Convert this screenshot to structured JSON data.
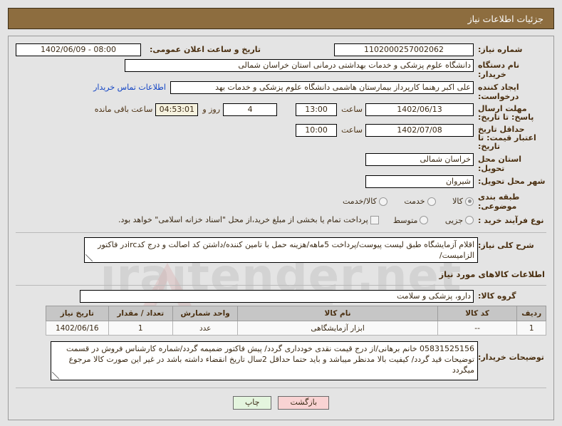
{
  "header": {
    "title": "جزئیات اطلاعات نیاز"
  },
  "form": {
    "need_number_label": "شماره نیاز:",
    "need_number_value": "1102000257002062",
    "announce_datetime_label": "تاریخ و ساعت اعلان عمومی:",
    "announce_datetime_value": "08:00 - 1402/06/09",
    "buyer_org_label": "نام دستگاه خریدار:",
    "buyer_org_value": "دانشگاه علوم پزشکی و خدمات بهداشتی درمانی استان خراسان شمالی",
    "creator_label": "ایجاد کننده درخواست:",
    "creator_value": "علی اکبر رهنما کارپرداز بیمارستان هاشمی دانشگاه علوم پزشکی و خدمات بهد",
    "contact_link": "اطلاعات تماس خریدار",
    "deadline_label": "مهلت ارسال پاسخ: تا تاریخ:",
    "deadline_date": "1402/06/13",
    "deadline_hour_label": "ساعت",
    "deadline_hour": "13:00",
    "remaining_days": "4",
    "remaining_days_label": "روز و",
    "remaining_time": "04:53:01",
    "remaining_time_label": "ساعت باقی مانده",
    "price_validity_label": "حداقل تاریخ اعتبار قیمت: تا تاریخ:",
    "price_validity_date": "1402/07/08",
    "price_validity_hour_label": "ساعت",
    "price_validity_hour": "10:00",
    "province_label": "استان محل تحویل:",
    "province_value": "خراسان شمالی",
    "city_label": "شهر محل تحویل:",
    "city_value": "شیروان",
    "category_label": "طبقه بندی موضوعی:",
    "category_options": [
      {
        "label": "کالا",
        "selected": true
      },
      {
        "label": "خدمت",
        "selected": false
      },
      {
        "label": "کالا/خدمت",
        "selected": false
      }
    ],
    "process_label": "نوع فرآیند خرید :",
    "process_options": [
      {
        "label": "جزیی",
        "selected": false
      },
      {
        "label": "متوسط",
        "selected": false
      }
    ],
    "treasury_checkbox_label": "پرداخت تمام یا بخشی از مبلغ خرید،از محل \"اسناد خزانه اسلامی\" خواهد بود.",
    "description_label": "شرح کلی نیاز:",
    "description_value": "اقلام آزمایشگاه طبق لیست پیوست/پرداخت 5ماهه/هزینه حمل با تامین کننده/داشتن کد اصالت و درج کدircدر فاکتور الزامیست/"
  },
  "goods_section": {
    "heading": "اطلاعات کالاهای مورد نیاز",
    "group_label": "گروه کالا:",
    "group_value": "دارو، پزشکی و سلامت",
    "columns": [
      "ردیف",
      "کد کالا",
      "نام کالا",
      "واحد شمارش",
      "تعداد / مقدار",
      "تاریخ نیاز"
    ],
    "rows": [
      {
        "index": "1",
        "code": "--",
        "name": "ابزار آزمایشگاهی",
        "unit": "عدد",
        "quantity": "1",
        "need_date": "1402/06/16"
      }
    ]
  },
  "buyer_notes": {
    "label": "توضیحات خریدار:",
    "value": "05831525156  خانم برهانی/از درج قیمت نقدی خودداری گردد/ پیش فاکتور ضمیمه گردد/شماره کارشناس فروش در قسمت توضیحات قید گردد/ کیفیت بالا مدنظر میباشد و باید حتما حداقل 2سال تاریخ انقضاء داشته باشد  در غیر این صورت کالا مرجوع میگردد"
  },
  "footer": {
    "back_label": "بازگشت",
    "print_label": "چاپ"
  },
  "watermark": {
    "text": "iraitender.net"
  }
}
